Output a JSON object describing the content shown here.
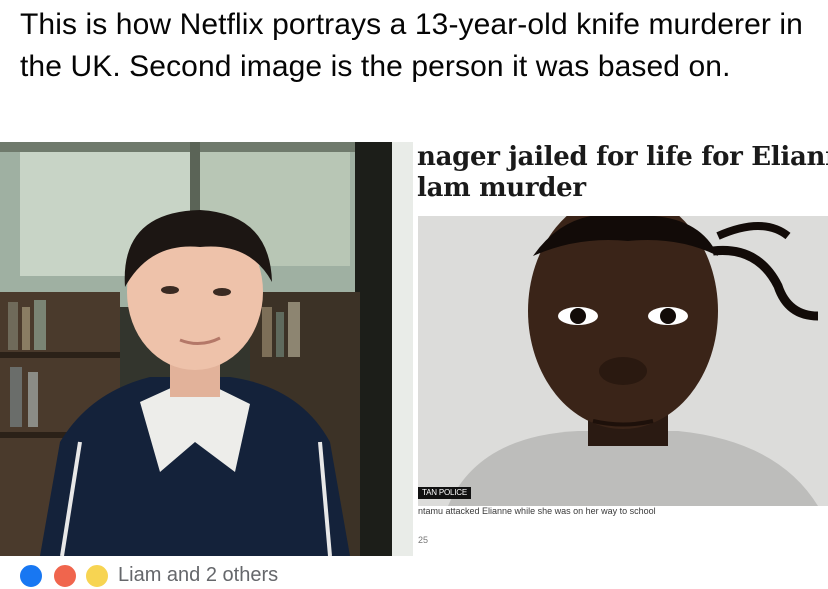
{
  "post": {
    "text": "This is how Netflix portrays a 13-year-old knife murderer in the UK. Second image is the person it was based on."
  },
  "article": {
    "headline_line1": "nager jailed for life for Elianne",
    "headline_line2": "lam murder",
    "credit": "TAN POLICE",
    "caption": "ntamu attacked Elianne while she was on her way to school",
    "date": "25"
  },
  "reactions": {
    "icons": [
      "like-icon",
      "love-icon",
      "care-icon"
    ],
    "colors": [
      "#1877f2",
      "#f0654d",
      "#f7d452"
    ],
    "names": "Liam and 2 others"
  }
}
